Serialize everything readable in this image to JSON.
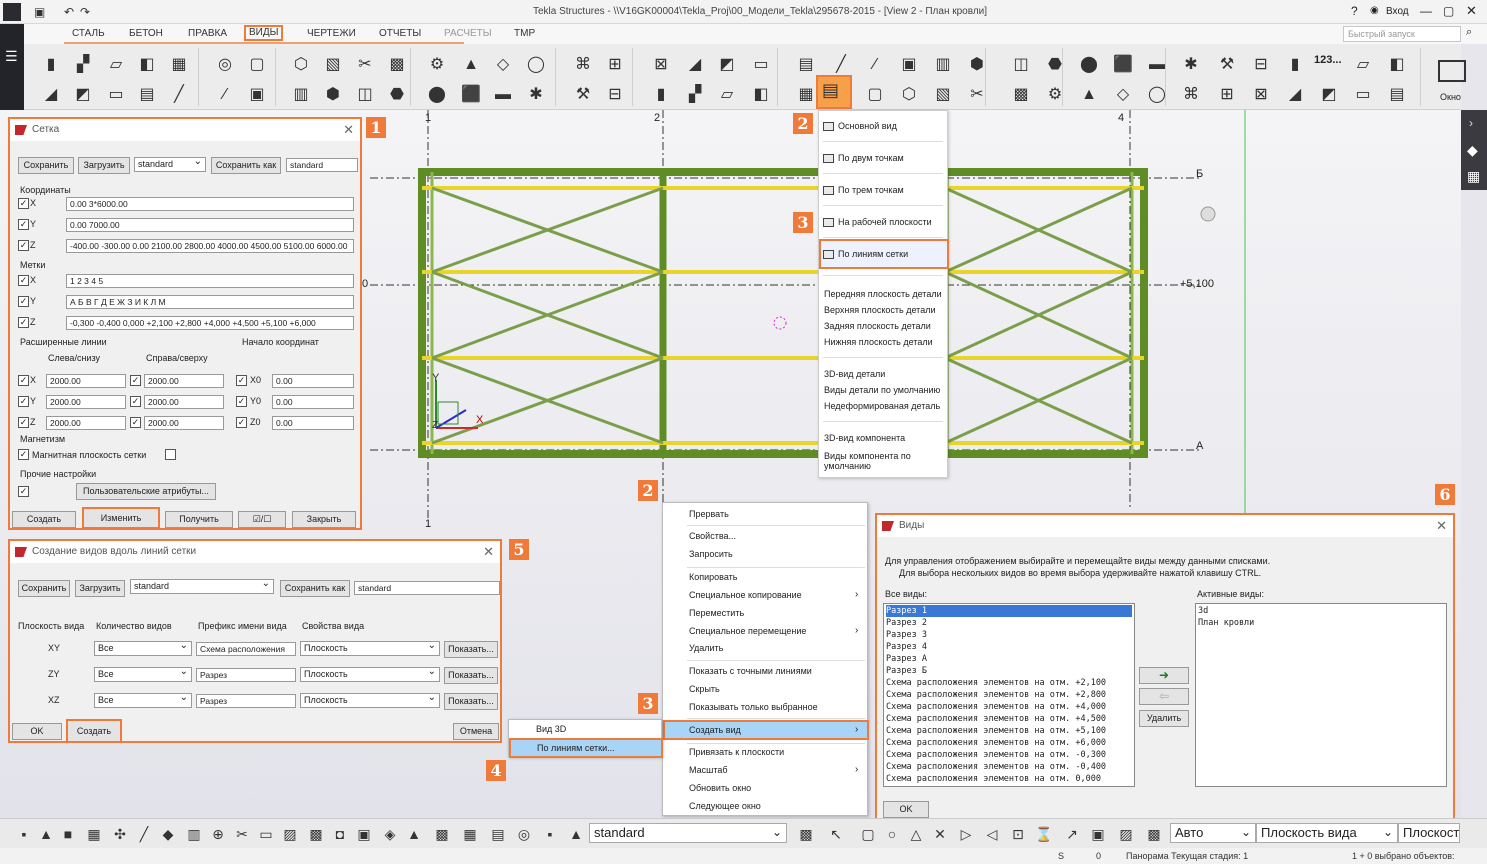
{
  "app": {
    "title": "Tekla Structures - \\\\V16GK00004\\Tekla_Proj\\00_Модели_Tekla\\295678-2015  - [View 2 - План кровли]",
    "login": "Вход",
    "search_placeholder": "Быстрый запуск"
  },
  "menu": [
    "СТАЛЬ",
    "БЕТОН",
    "ПРАВКА",
    "ВИДЫ",
    "ЧЕРТЕЖИ",
    "ОТЧЕТЫ",
    "РАСЧЕТЫ",
    "TMP"
  ],
  "ribbon": {
    "window_label": "Окно",
    "number_label": "123..."
  },
  "view_dropdown": {
    "items": [
      "Основной вид",
      "По двум точкам",
      "По трем точкам",
      "На рабочей плоскости",
      "По линиям сетки",
      "Передняя плоскость детали",
      "Верхняя плоскость детали",
      "Задняя плоскость детали",
      "Нижняя плоскость детали",
      "3D-вид детали",
      "Виды детали по умолчанию",
      "Недеформированая деталь",
      "3D-вид компонента",
      "Виды компонента по умолчанию"
    ]
  },
  "grid_dialog": {
    "title": "Сетка",
    "save": "Сохранить",
    "load": "Загрузить",
    "preset": "standard",
    "save_as": "Сохранить как",
    "save_as_value": "standard",
    "coords_label": "Координаты",
    "x": "0.00 3*6000.00",
    "y": "0.00 7000.00",
    "z": "-400.00 -300.00 0.00 2100.00 2800.00 4000.00 4500.00 5100.00 6000.00",
    "labels_label": "Метки",
    "lx": "1 2 3 4 5",
    "ly": "А Б В Г Д Е Ж З И К Л М",
    "lz": "-0,300 -0,400 0,000 +2,100 +2,800 +4,000 +4,500 +5,100 +6,000",
    "ext_label": "Расширенные линии",
    "left_bottom": "Слева/снизу",
    "right_top": "Справа/сверху",
    "origin_label": "Начало координат",
    "ext_x1": "2000.00",
    "ext_x2": "2000.00",
    "ext_y1": "2000.00",
    "ext_y2": "2000.00",
    "ext_z1": "2000.00",
    "ext_z2": "2000.00",
    "x0": "X0",
    "y0": "Y0",
    "z0": "Z0",
    "x0v": "0.00",
    "y0v": "0.00",
    "z0v": "0.00",
    "magnet_label": "Магнетизм",
    "magnet_plane": "Магнитная плоскость сетки",
    "other_label": "Прочие настройки",
    "user_attr": "Пользовательские атрибуты...",
    "create": "Создать",
    "modify": "Изменить",
    "get": "Получить",
    "toggle": "/",
    "close": "Закрыть",
    "ax": "X",
    "ay": "Y",
    "az": "Z"
  },
  "gridviews_dialog": {
    "title": "Создание видов вдоль линий сетки",
    "save": "Сохранить",
    "load": "Загрузить",
    "preset": "standard",
    "save_as": "Сохранить как",
    "save_as_value": "standard",
    "h_plane": "Плоскость вида",
    "h_count": "Количество видов",
    "h_prefix": "Префикс имени вида",
    "h_props": "Свойства вида",
    "rows": [
      {
        "plane": "XY",
        "count": "Все",
        "prefix": "Схема расположения",
        "props": "Плоскость",
        "show": "Показать..."
      },
      {
        "plane": "ZY",
        "count": "Все",
        "prefix": "Разрез",
        "props": "Плоскость",
        "show": "Показать..."
      },
      {
        "plane": "XZ",
        "count": "Все",
        "prefix": "Разрез",
        "props": "Плоскость",
        "show": "Показать..."
      }
    ],
    "ok": "OK",
    "create": "Создать",
    "cancel": "Отмена"
  },
  "context_menu": {
    "items": [
      "Прервать",
      "Свойства...",
      "Запросить",
      "Копировать",
      "Специальное копирование",
      "Переместить",
      "Специальное перемещение",
      "Удалить",
      "Показать с точными линиями",
      "Скрыть",
      "Показывать только выбранное",
      "Создать вид",
      "Привязать к плоскости",
      "Масштаб",
      "Обновить окно",
      "Следующее окно"
    ]
  },
  "submenu": {
    "items": [
      "Вид 3D",
      "По линиям сетки..."
    ]
  },
  "views_dialog": {
    "title": "Виды",
    "desc1": "Для управления отображением выбирайте и перемещайте виды между данными списками.",
    "desc2": "Для выбора нескольких видов во время выбора удерживайте нажатой клавишу CTRL.",
    "all_label": "Все виды:",
    "active_label": "Активные виды:",
    "all": [
      "Разрез 1",
      "Разрез 2",
      "Разрез 3",
      "Разрез 4",
      "Разрез А",
      "Разрез Б",
      "Схема расположения элементов на отм. +2,100",
      "Схема расположения элементов на отм. +2,800",
      "Схема расположения элементов на отм. +4,000",
      "Схема расположения элементов на отм. +4,500",
      "Схема расположения элементов на отм. +5,100",
      "Схема расположения элементов на отм. +6,000",
      "Схема расположения элементов на отм. -0,300",
      "Схема расположения элементов на отм. -0,400",
      "Схема расположения элементов на отм. 0,000"
    ],
    "active": [
      "3d",
      "План кровли"
    ],
    "delete": "Удалить",
    "ok": "OK"
  },
  "badges": [
    "1",
    "2",
    "3",
    "2",
    "3",
    "4",
    "5",
    "6"
  ],
  "canvas": {
    "axis1": "1",
    "axis2": "2",
    "axis4": "4",
    "axisB": "Б",
    "axisA": "А",
    "elev": "+5,100",
    "elev_left": "0",
    "ax_y": "Y",
    "ax_x": "X",
    "ax_z": "Z"
  },
  "status": {
    "filter": "standard",
    "auto": "Авто",
    "plane": "Плоскость вида",
    "plane2": "Плоскость",
    "s": "S",
    "zero": "0",
    "panel": "Панорама Текущая стадия: 1",
    "selected": "1 + 0 выбрано объектов:"
  },
  "colors": {
    "accent": "#f07a3a",
    "beam": "#6b8e23",
    "yellow": "#e8d42a",
    "menu_hl": "#a8d4f5"
  }
}
